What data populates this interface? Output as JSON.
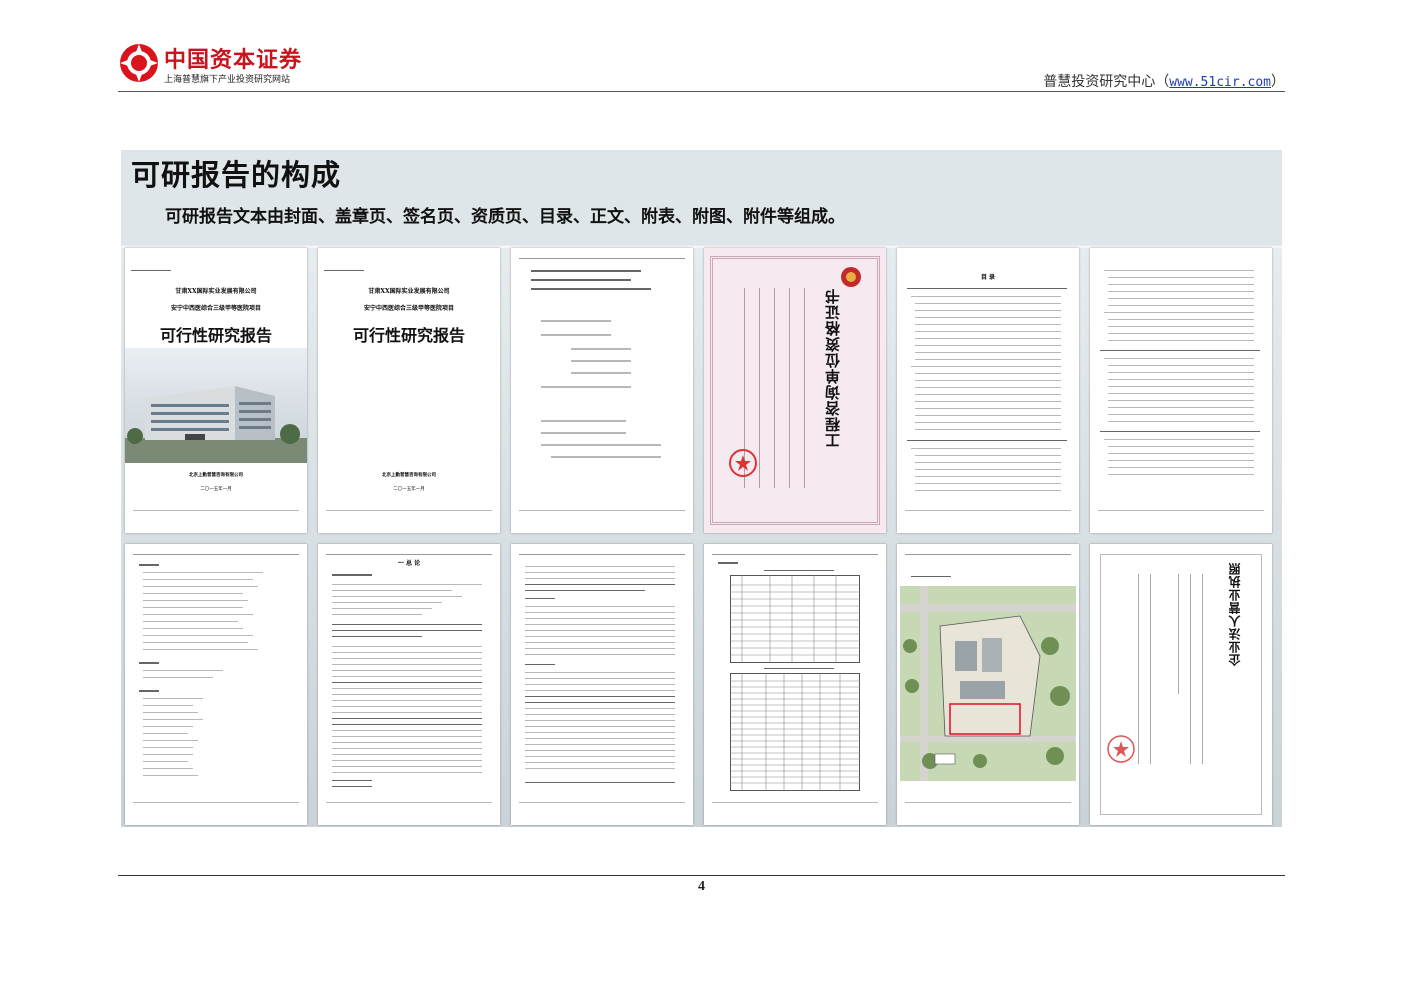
{
  "header": {
    "logo_title": "中国资本证券",
    "logo_subtitle": "上海普慧旗下产业投资研究网站",
    "site_name": "普慧投资研究中心（",
    "site_url": "www.51cir.com",
    "site_close": "）"
  },
  "slide": {
    "title": "可研报告的构成",
    "subtitle": "可研报告文本由封面、盖章页、签名页、资质页、目录、正文、附表、附图、附件等组成。"
  },
  "thumbs": {
    "cover1": {
      "line1": "甘肃XX国际实业发展有限公司",
      "line2": "安宁中西医综合三级甲等医院项目",
      "line3": "可行性研究报告",
      "company": "北京上勤普慧咨询有限公司",
      "date": "二〇一五年一月"
    },
    "cover2": {
      "line1": "甘肃XX国际实业发展有限公司",
      "line2": "安宁中西医综合三级甲等医院项目",
      "line3": "可行性研究报告",
      "company": "北京上勤普慧咨询有限公司",
      "date": "二〇一五年一月"
    },
    "cert": {
      "title": "工程咨询单位资格证书"
    },
    "toc": {
      "title": "目 录"
    },
    "body1": {
      "title": "一 总 论"
    },
    "license": {
      "title": "企业法人营业执照"
    }
  },
  "footer": {
    "page_number": "4"
  }
}
